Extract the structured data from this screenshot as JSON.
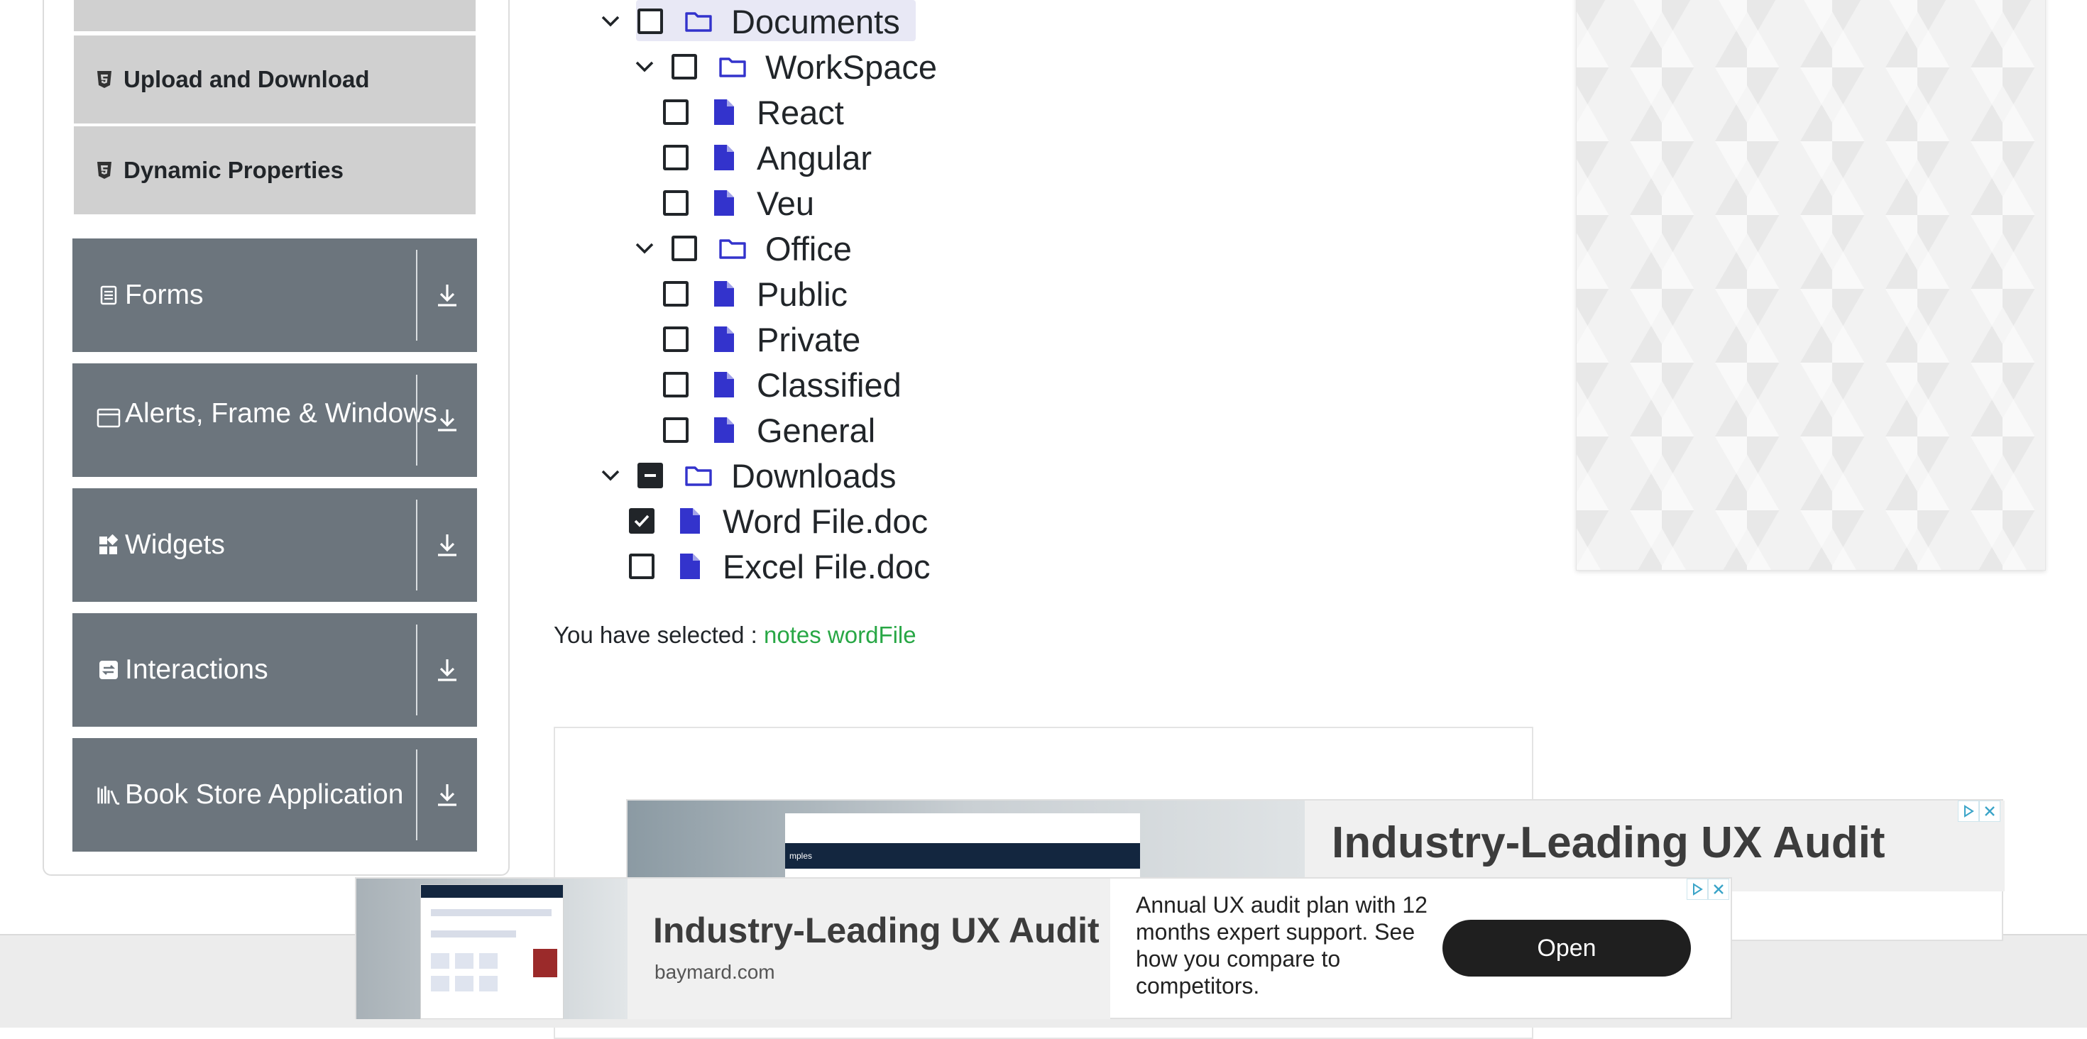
{
  "sidebar": {
    "sub_items": [
      {
        "label": "Upload and Download",
        "icon": "html5-icon"
      },
      {
        "label": "Dynamic Properties",
        "icon": "html5-icon"
      }
    ],
    "groups": [
      {
        "label": "Forms",
        "icon": "form-icon"
      },
      {
        "label": "Alerts, Frame & Windows",
        "icon": "browser-window-icon"
      },
      {
        "label": "Widgets",
        "icon": "widgets-icon"
      },
      {
        "label": "Interactions",
        "icon": "interactions-icon"
      },
      {
        "label": "Book Store Application",
        "icon": "books-icon"
      }
    ]
  },
  "tree": {
    "nodes": [
      {
        "label": "Documents",
        "type": "folder",
        "level": 0,
        "expanded": true,
        "state": "unchecked"
      },
      {
        "label": "WorkSpace",
        "type": "folder",
        "level": 1,
        "expanded": true,
        "state": "unchecked"
      },
      {
        "label": "React",
        "type": "file",
        "level": 2,
        "state": "unchecked"
      },
      {
        "label": "Angular",
        "type": "file",
        "level": 2,
        "state": "unchecked"
      },
      {
        "label": "Veu",
        "type": "file",
        "level": 2,
        "state": "unchecked"
      },
      {
        "label": "Office",
        "type": "folder",
        "level": 1,
        "expanded": true,
        "state": "unchecked"
      },
      {
        "label": "Public",
        "type": "file",
        "level": 2,
        "state": "unchecked"
      },
      {
        "label": "Private",
        "type": "file",
        "level": 2,
        "state": "unchecked"
      },
      {
        "label": "Classified",
        "type": "file",
        "level": 2,
        "state": "unchecked"
      },
      {
        "label": "General",
        "type": "file",
        "level": 2,
        "state": "unchecked"
      },
      {
        "label": "Downloads",
        "type": "folder",
        "level": 0,
        "expanded": true,
        "state": "indeterminate"
      },
      {
        "label": "Word File.doc",
        "type": "file",
        "level": 1,
        "state": "checked"
      },
      {
        "label": "Excel File.doc",
        "type": "file",
        "level": 1,
        "state": "unchecked"
      }
    ]
  },
  "result": {
    "prefix": "You have selected :",
    "values": "notes wordFile"
  },
  "ads": {
    "back": {
      "headline": "Industry-Leading UX Audit",
      "thumb_text": "mples"
    },
    "front": {
      "headline": "Industry-Leading UX Audit",
      "domain": "baymard.com",
      "description": "Annual UX audit plan with 12 months expert support. See how you compare to competitors.",
      "cta": "Open"
    }
  },
  "colors": {
    "accent_blue": "#3333cc",
    "selected_green": "#28a745",
    "group_gray": "#6c757d",
    "sub_item_gray": "#d0d0d0"
  }
}
